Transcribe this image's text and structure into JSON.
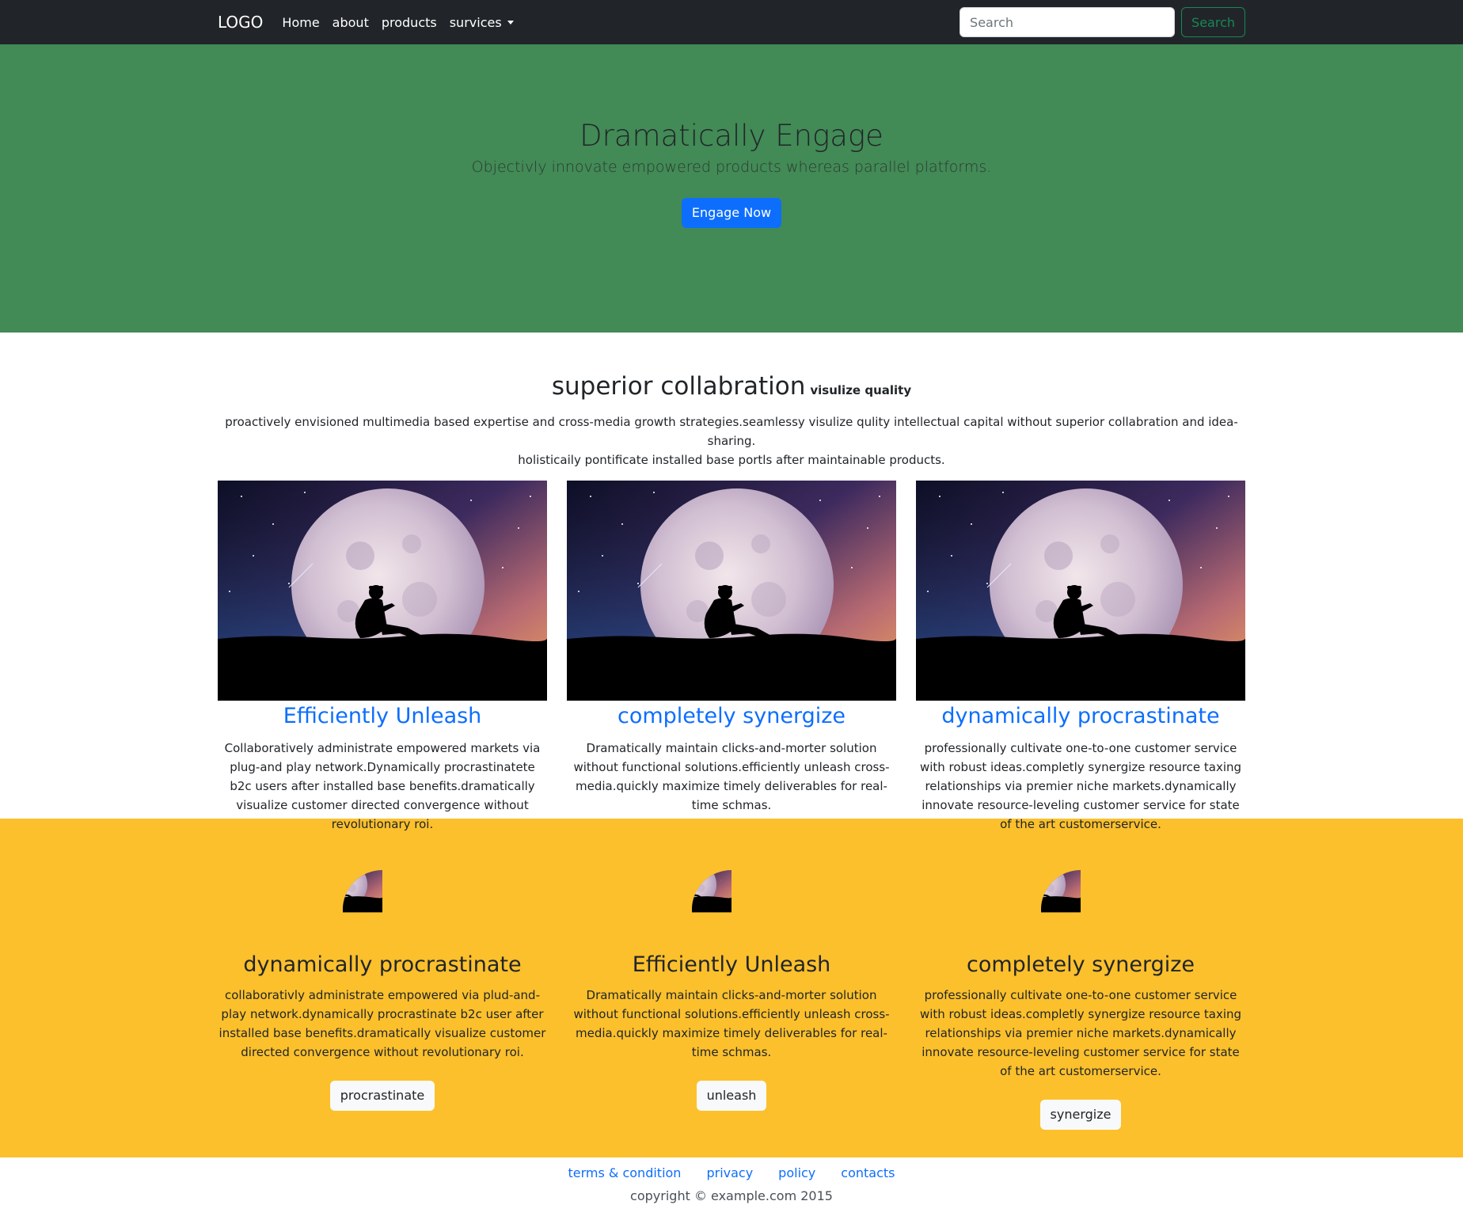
{
  "navbar": {
    "brand": "LOGO",
    "links": [
      "Home",
      "about",
      "products",
      "survices"
    ],
    "search": {
      "placeholder": "Search",
      "button_label": "Search"
    }
  },
  "hero": {
    "title": "Dramatically Engage",
    "subtitle": "Objectivly innovate empowered products whereas parallel platforms.",
    "button_label": "Engage Now"
  },
  "collab": {
    "title": "superior collabration",
    "title_small": "visulize quality",
    "description_line1": "proactively envisioned multimedia based expertise and cross-media growth strategies.seamlessy visulize qulity intellectual capital without superior collabration and idea-sharing.",
    "description_line2": "holisticaily pontificate installed base portls after maintainable products.",
    "cards": [
      {
        "title": "Efficiently Unleash",
        "text": "Collaboratively administrate empowered markets via plug-and play network.Dynamically procrastinatete b2c users after installed base benefits.dramatically visualize customer directed convergence without revolutionary roi."
      },
      {
        "title": "completely synergize",
        "text": "Dramatically maintain clicks-and-morter solution without functional solutions.efficiently unleash cross-media.quickly maximize timely deliverables for real-time schmas."
      },
      {
        "title": "dynamically procrastinate",
        "text": "professionally cultivate one-to-one customer service with robust ideas.completly synergize resource taxing relationships via premier niche markets.dynamically innovate resource-leveling customer service for state of the art customerservice."
      }
    ]
  },
  "features": [
    {
      "title": "dynamically procrastinate",
      "text": "collaborativly administrate empowered via plud-and-play network.dynamically procrastinate b2c user after installed base benefits.dramatically visualize customer directed convergence without revolutionary roi.",
      "button_label": "procrastinate"
    },
    {
      "title": "Efficiently Unleash",
      "text": "Dramatically maintain clicks-and-morter solution without functional solutions.efficiently unleash cross-media.quickly maximize timely deliverables for real-time schmas.",
      "button_label": "unleash"
    },
    {
      "title": "completely synergize",
      "text": "professionally cultivate one-to-one customer service with robust ideas.completly synergize resource taxing relationships via premier niche markets.dynamically innovate resource-leveling customer service for state of the art customerservice.",
      "button_label": "synergize"
    }
  ],
  "footer": {
    "links": [
      "terms & condition",
      "privacy",
      "policy",
      "contacts"
    ],
    "copyright": "copyright © example.com 2015"
  },
  "colors": {
    "navbar_bg": "#212529",
    "hero_bg": "#428a56",
    "features_bg": "#fcc02c",
    "link_blue": "#0d6efd",
    "search_green": "#198754"
  },
  "icons": {
    "dropdown": "caret-down-icon"
  }
}
